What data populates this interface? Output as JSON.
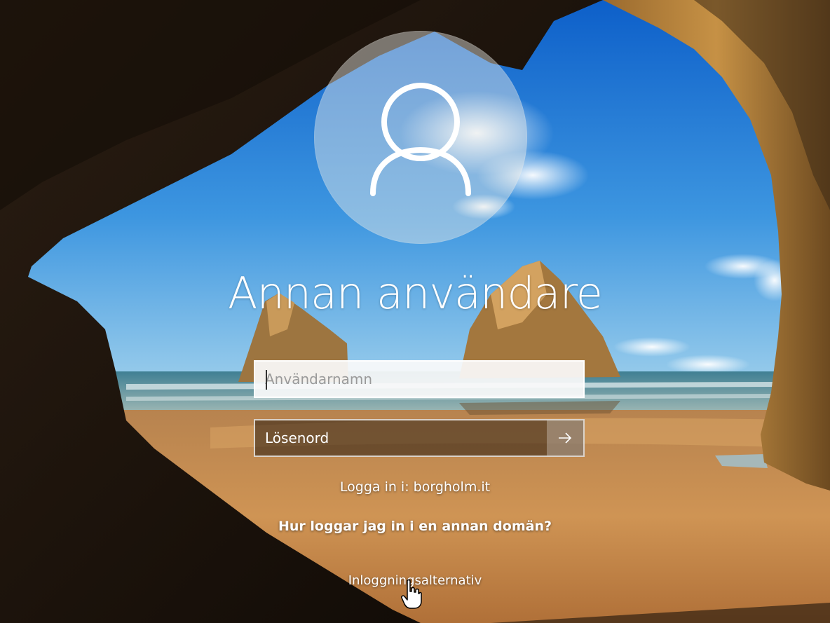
{
  "login": {
    "username_display": "Annan användare",
    "username_placeholder": "Användarnamn",
    "password_placeholder": "Lösenord",
    "domain_label": "Logga in i: borgholm.it",
    "help_link": "Hur loggar jag in i en annan domän?",
    "options_link": "Inloggningsalternativ"
  },
  "icons": {
    "avatar": "user-icon",
    "submit": "arrow-right-icon",
    "cursor": "hand-pointer-icon"
  },
  "colors": {
    "text": "#ffffff",
    "sky": "#1f7fd8",
    "sand": "#c98a45",
    "rock": "#1a120b"
  }
}
